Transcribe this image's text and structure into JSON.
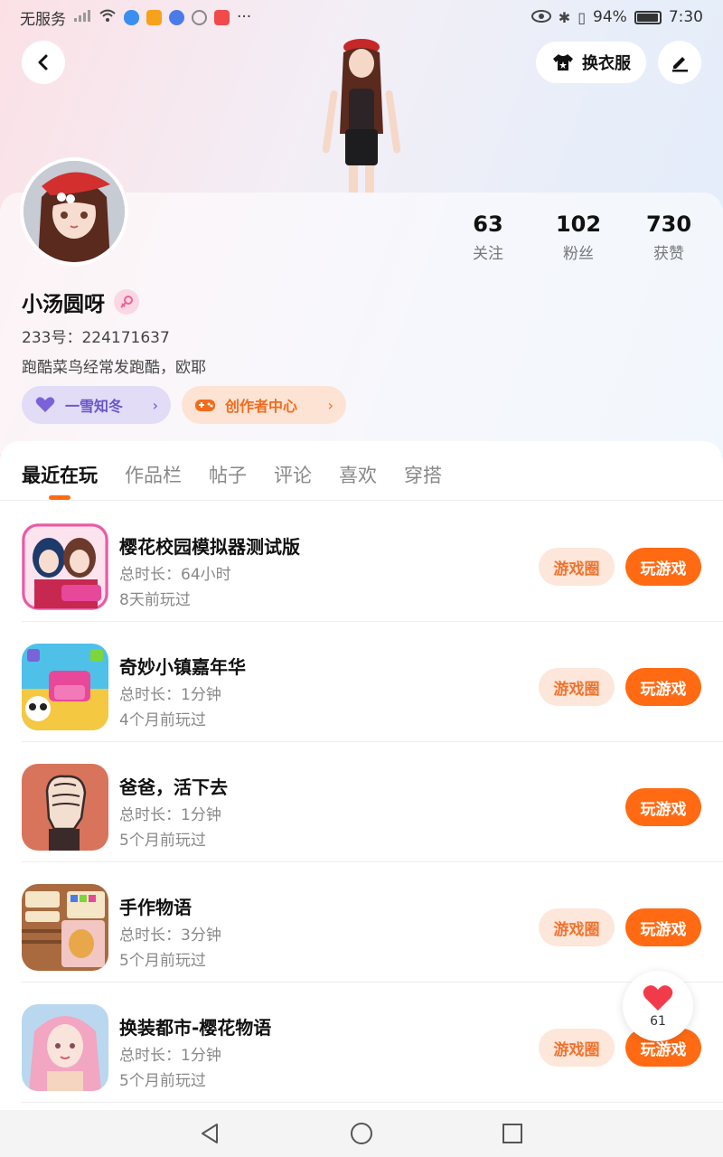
{
  "status_bar": {
    "carrier": "无服务",
    "battery_percent": "94%",
    "time": "7:30"
  },
  "header": {
    "outfit_label": "换衣服"
  },
  "profile": {
    "stats": [
      {
        "value": "63",
        "label": "关注"
      },
      {
        "value": "102",
        "label": "粉丝"
      },
      {
        "value": "730",
        "label": "获赞"
      }
    ],
    "username": "小汤圆呀",
    "user_id": "233号：224171637",
    "bio": "跑酷菜鸟经常发跑酷，欧耶",
    "chip_guild": "一雪知冬",
    "chip_creator": "创作者中心"
  },
  "tabs": [
    {
      "label": "最近在玩",
      "active": true
    },
    {
      "label": "作品栏",
      "active": false
    },
    {
      "label": "帖子",
      "active": false
    },
    {
      "label": "评论",
      "active": false
    },
    {
      "label": "喜欢",
      "active": false
    },
    {
      "label": "穿搭",
      "active": false
    }
  ],
  "games": [
    {
      "title": "樱花校园模拟器测试版",
      "time": "总时长：64小时",
      "last": "8天前玩过",
      "circle": "游戏圈",
      "play": "玩游戏",
      "icon": "sakura-school-icon"
    },
    {
      "title": "奇妙小镇嘉年华",
      "time": "总时长：1分钟",
      "last": "4个月前玩过",
      "circle": "游戏圈",
      "play": "玩游戏",
      "icon": "town-carnival-icon"
    },
    {
      "title": "爸爸，活下去",
      "time": "总时长：1分钟",
      "last": "5个月前玩过",
      "circle": "",
      "play": "玩游戏",
      "icon": "fist-icon"
    },
    {
      "title": "手作物语",
      "time": "总时长：3分钟",
      "last": "5个月前玩过",
      "circle": "游戏圈",
      "play": "玩游戏",
      "icon": "handcraft-icon"
    },
    {
      "title": "换装都市-樱花物语",
      "time": "总时长：1分钟",
      "last": "5个月前玩过",
      "circle": "游戏圈",
      "play": "玩游戏",
      "icon": "dressup-city-icon"
    }
  ],
  "like_float": {
    "count": "61"
  },
  "colors": {
    "accent": "#ff6a13",
    "purple_chip": "#6b56c8"
  }
}
